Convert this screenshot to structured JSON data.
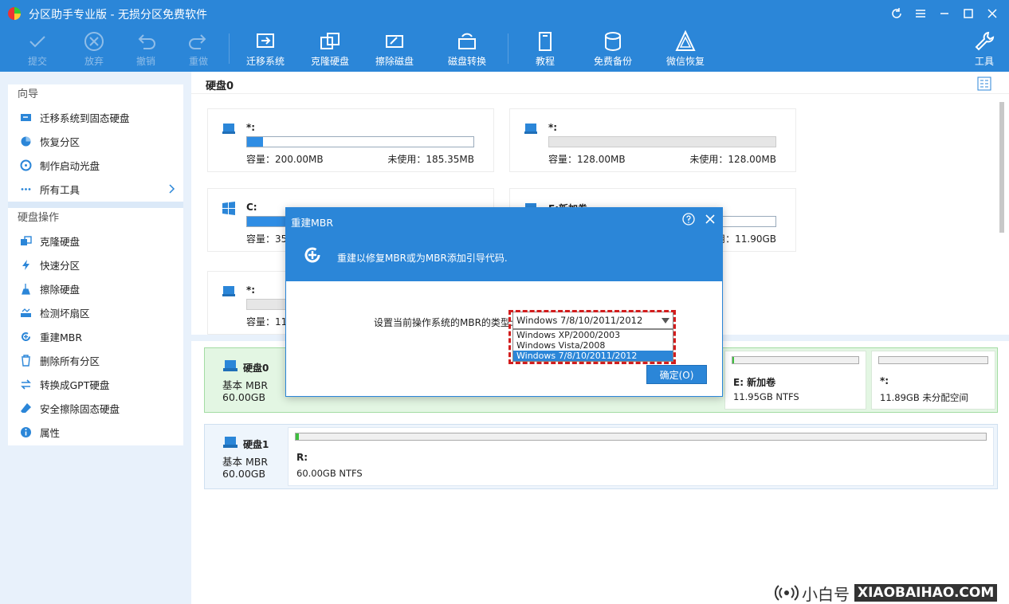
{
  "window": {
    "title": "分区助手专业版 - 无损分区免费软件"
  },
  "toolbar": {
    "items": [
      {
        "label": "提交",
        "icon": "check-icon",
        "enabled": false
      },
      {
        "label": "放弃",
        "icon": "cancel-circle-icon",
        "enabled": false
      },
      {
        "label": "撤销",
        "icon": "undo-icon",
        "enabled": false
      },
      {
        "label": "重做",
        "icon": "redo-icon",
        "enabled": false
      },
      {
        "label": "迁移系统",
        "icon": "migrate-os-icon",
        "enabled": true
      },
      {
        "label": "克隆硬盘",
        "icon": "clone-disk-icon",
        "enabled": true
      },
      {
        "label": "擦除磁盘",
        "icon": "wipe-disk-icon",
        "enabled": true
      },
      {
        "label": "磁盘转换",
        "icon": "convert-disk-icon",
        "enabled": true
      },
      {
        "label": "教程",
        "icon": "book-icon",
        "enabled": true
      },
      {
        "label": "免费备份",
        "icon": "backup-icon",
        "enabled": true
      },
      {
        "label": "微信恢复",
        "icon": "recover-icon",
        "enabled": true
      },
      {
        "label": "工具",
        "icon": "wrench-icon",
        "enabled": true
      }
    ]
  },
  "sidebar": {
    "wizard_heading": "向导",
    "wizard_items": [
      {
        "label": "迁移系统到固态硬盘",
        "icon": "migrate-ssd-icon"
      },
      {
        "label": "恢复分区",
        "icon": "pie-recover-icon"
      },
      {
        "label": "制作启动光盘",
        "icon": "boot-disc-icon"
      },
      {
        "label": "所有工具",
        "icon": "more-dots-icon"
      }
    ],
    "disk_heading": "硬盘操作",
    "disk_items": [
      {
        "label": "克隆硬盘",
        "icon": "clone-icon"
      },
      {
        "label": "快速分区",
        "icon": "lightning-icon"
      },
      {
        "label": "擦除硬盘",
        "icon": "broom-icon"
      },
      {
        "label": "检测坏扇区",
        "icon": "scan-icon"
      },
      {
        "label": "重建MBR",
        "icon": "rebuild-mbr-icon"
      },
      {
        "label": "删除所有分区",
        "icon": "trash-icon"
      },
      {
        "label": "转换成GPT硬盘",
        "icon": "convert-icon"
      },
      {
        "label": "安全擦除固态硬盘",
        "icon": "eraser-icon"
      },
      {
        "label": "属性",
        "icon": "info-icon"
      }
    ]
  },
  "main": {
    "disk_title": "硬盘0",
    "cards": [
      {
        "name": "*:",
        "cap": "容量：200.00MB",
        "free": "未使用：185.35MB",
        "used_fraction": 0.07
      },
      {
        "name": "*:",
        "cap": "容量：128.00MB",
        "free": "未使用：128.00MB",
        "used_fraction": 0
      },
      {
        "name": "C:",
        "cap": "容量：35.",
        "free": "",
        "used_fraction": 0.6
      },
      {
        "name": "E:新加卷",
        "cap": "",
        "free": "使用：11.90GB",
        "used_fraction": 0.01
      },
      {
        "name": "*:",
        "cap": "容量：11.",
        "free": "",
        "used_fraction": 0
      }
    ]
  },
  "disk_map": {
    "disk0": {
      "name": "硬盘0",
      "type": "基本 MBR",
      "size": "60.00GB"
    },
    "disk0_parts": [
      {
        "name": "E: 新加卷",
        "info": "11.95GB NTFS"
      },
      {
        "name": "*:",
        "info": "11.89GB 未分配空间"
      }
    ],
    "disk1": {
      "name": "硬盘1",
      "type": "基本 MBR",
      "size": "60.00GB"
    },
    "disk1_part": {
      "name": "R:",
      "info": "60.00GB NTFS"
    }
  },
  "dialog": {
    "title": "重建MBR",
    "description": "重建以修复MBR或为MBR添加引导代码.",
    "label": "设置当前操作系统的MBR的类型:",
    "selected": "Windows 7/8/10/2011/2012",
    "options": [
      "Windows XP/2000/2003",
      "Windows Vista/2008",
      "Windows 7/8/10/2011/2012"
    ],
    "ok_label": "确定(O)"
  },
  "watermark": {
    "cn": "小白号",
    "en": "XIAOBAIHAO.COM"
  },
  "colors": {
    "accent": "#2b86d8",
    "highlight": "#d21d1d",
    "disk_green": "#3fbf3f"
  }
}
